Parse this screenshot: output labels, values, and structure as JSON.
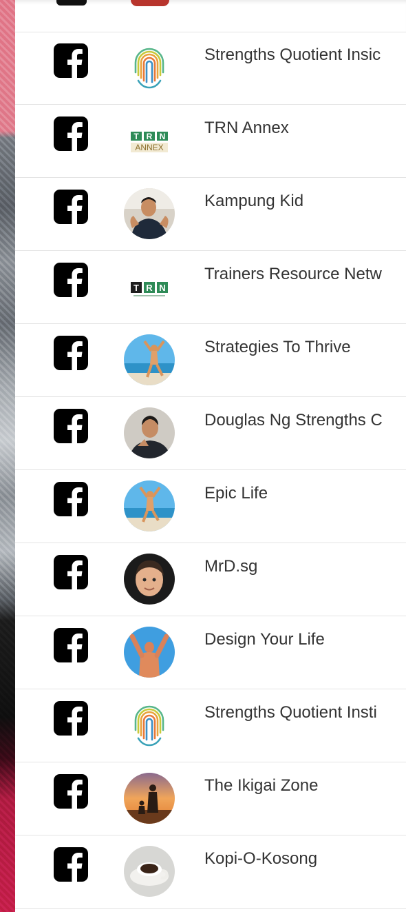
{
  "page": {
    "rows": [
      {
        "name": "Strengths Quotient Insic",
        "social": "facebook-icon",
        "avatar": "fingerprint-logo"
      },
      {
        "name": "TRN Annex",
        "social": "facebook-icon",
        "avatar": "trn-annex-logo",
        "logo_text": [
          "T",
          "R",
          "N",
          "ANNEX"
        ]
      },
      {
        "name": "Kampung Kid",
        "social": "facebook-icon",
        "avatar": "man-photo"
      },
      {
        "name": "Trainers Resource Netw",
        "social": "facebook-icon",
        "avatar": "trn-logo",
        "logo_text": [
          "T",
          "R",
          "N"
        ]
      },
      {
        "name": "Strategies To Thrive",
        "social": "facebook-icon",
        "avatar": "beach-jump-photo"
      },
      {
        "name": "Douglas Ng Strengths C",
        "social": "facebook-icon",
        "avatar": "man-portrait"
      },
      {
        "name": "Epic Life",
        "social": "facebook-icon",
        "avatar": "beach-jump-photo"
      },
      {
        "name": "MrD.sg",
        "social": "facebook-icon",
        "avatar": "3d-avatar"
      },
      {
        "name": "Design Your Life",
        "social": "facebook-icon",
        "avatar": "arms-raised-photo"
      },
      {
        "name": "Strengths Quotient Insti",
        "social": "facebook-icon",
        "avatar": "fingerprint-logo"
      },
      {
        "name": "The Ikigai Zone",
        "social": "facebook-icon",
        "avatar": "sunset-family-photo"
      },
      {
        "name": "Kopi-O-Kosong",
        "social": "facebook-icon",
        "avatar": "coffee-cup-photo"
      }
    ]
  },
  "colors": {
    "facebook_icon": "#000000",
    "text": "#333333",
    "divider": "#e4e4e4",
    "trn_green": "#2e8b57"
  }
}
